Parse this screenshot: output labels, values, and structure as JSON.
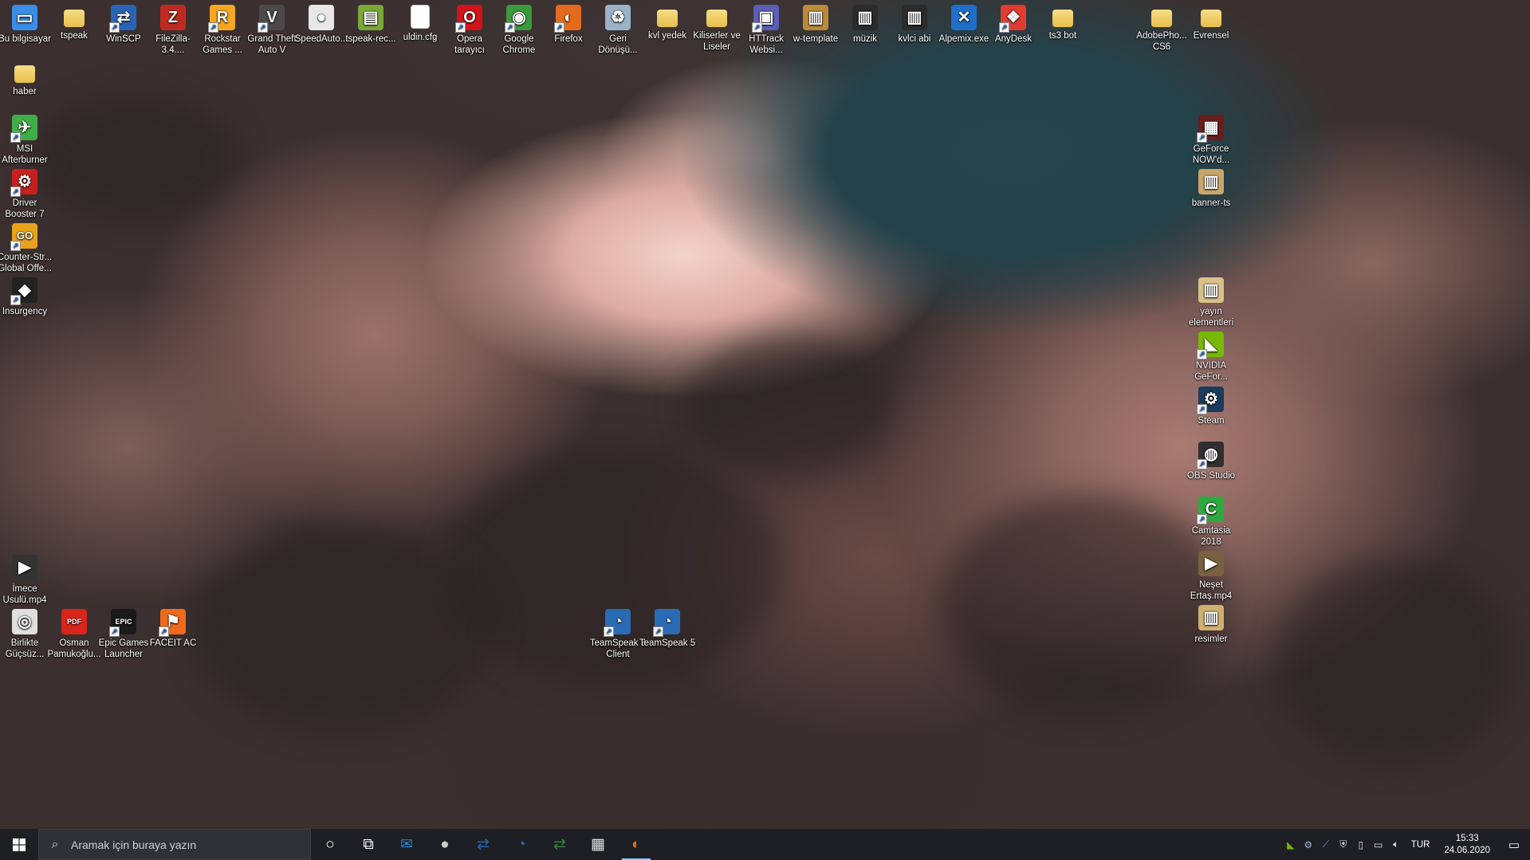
{
  "desktop": {
    "icons_top_row": [
      {
        "name": "bu-bilgisayar",
        "label": "Bu bilgisayar",
        "kind": "computer",
        "color": "#3a8ee8",
        "short": false
      },
      {
        "name": "tspeak",
        "label": "tspeak",
        "kind": "folder",
        "color": "#f0cc5c",
        "short": false
      },
      {
        "name": "winscp",
        "label": "WinSCP",
        "kind": "app",
        "color": "#2b63b7",
        "glyph": "⇄",
        "short": true
      },
      {
        "name": "filezilla",
        "label": "FileZilla-3.4....",
        "kind": "app",
        "color": "#bf2b20",
        "glyph": "Z",
        "short": false
      },
      {
        "name": "rockstar-games",
        "label": "Rockstar Games ...",
        "kind": "app",
        "color": "#f5a623",
        "glyph": "R",
        "short": true
      },
      {
        "name": "gta-v",
        "label": "Grand Theft Auto V",
        "kind": "app",
        "color": "#4a4a4a",
        "glyph": "V",
        "short": true
      },
      {
        "name": "speedauto",
        "label": "SpeedAuto...",
        "kind": "app",
        "color": "#e8e8e8",
        "glyph": "●",
        "short": false
      },
      {
        "name": "tspeak-rec",
        "label": "tspeak-rec...",
        "kind": "app",
        "color": "#7aa63a",
        "glyph": "▤",
        "short": false
      },
      {
        "name": "uldin-cfg",
        "label": "uldin.cfg",
        "kind": "doc",
        "color": "#ffffff",
        "short": false
      },
      {
        "name": "opera",
        "label": "Opera tarayıcı",
        "kind": "app",
        "color": "#d0141b",
        "glyph": "O",
        "short": true
      },
      {
        "name": "google-chrome",
        "label": "Google Chrome",
        "kind": "app",
        "color": "#3b9a3b",
        "glyph": "◉",
        "short": true
      },
      {
        "name": "firefox",
        "label": "Firefox",
        "kind": "app",
        "color": "#e66a1b",
        "glyph": "◐",
        "short": true
      },
      {
        "name": "geri-donusum",
        "label": "Geri Dönüşü...",
        "kind": "app",
        "color": "#9ab3c8",
        "glyph": "♻",
        "short": false
      },
      {
        "name": "kvl-yedek",
        "label": "kvl yedek",
        "kind": "folder",
        "color": "#f0cc5c",
        "short": false
      },
      {
        "name": "kiliserler-ve-liseler",
        "label": "Kiliserler ve Liseler",
        "kind": "folder",
        "color": "#f0cc5c",
        "short": false
      },
      {
        "name": "httrack",
        "label": "HTTrack Websi...",
        "kind": "app",
        "color": "#5b5fb6",
        "glyph": "▣",
        "short": true
      },
      {
        "name": "w-template",
        "label": "w-template",
        "kind": "app",
        "color": "#b88a3a",
        "glyph": "▥",
        "short": false
      },
      {
        "name": "muzik",
        "label": "müzik",
        "kind": "app",
        "color": "#2b2b2b",
        "glyph": "▥",
        "short": false
      },
      {
        "name": "kvlci-abi",
        "label": "kvlci abi",
        "kind": "app",
        "color": "#2b2b2b",
        "glyph": "▥",
        "short": false
      },
      {
        "name": "alpemix",
        "label": "Alpemix.exe",
        "kind": "app",
        "color": "#1f6fc9",
        "glyph": "✕",
        "short": false
      },
      {
        "name": "anydesk",
        "label": "AnyDesk",
        "kind": "app",
        "color": "#e03c31",
        "glyph": "❖",
        "short": true
      },
      {
        "name": "ts3-bot",
        "label": "ts3 bot",
        "kind": "folder",
        "color": "#f0cc5c",
        "short": false
      },
      {
        "name": "adobephoto-cs6",
        "label": "AdobePho... CS6",
        "kind": "folder",
        "color": "#f0cc5c",
        "short": false
      },
      {
        "name": "evrensel",
        "label": "Evrensel",
        "kind": "folder",
        "color": "#f0cc5c",
        "short": false
      }
    ],
    "icons_left_col": [
      {
        "name": "haber",
        "label": "haber",
        "kind": "folder",
        "color": "#f0cc5c",
        "short": false
      },
      {
        "name": "msi-afterburner",
        "label": "MSI Afterburner",
        "kind": "app",
        "color": "#3fae49",
        "glyph": "✈",
        "short": true
      },
      {
        "name": "driver-booster-7",
        "label": "Driver Booster 7",
        "kind": "app",
        "color": "#c8201e",
        "glyph": "⚙",
        "short": true
      },
      {
        "name": "csgo",
        "label": "Counter-Str... Global Offe...",
        "kind": "app",
        "color": "#e8a21b",
        "glyph": "GO",
        "short": true
      },
      {
        "name": "insurgency",
        "label": "Insurgency",
        "kind": "app",
        "color": "#222222",
        "glyph": "◆",
        "short": true
      },
      {
        "name": "imece-usulu",
        "label": "İmece Usulü.mp4",
        "kind": "app",
        "color": "#333333",
        "glyph": "▶",
        "short": false
      },
      {
        "name": "birlikte-gucsuz",
        "label": "Birlikte Güçsüz...",
        "kind": "app",
        "color": "#e0e0e0",
        "glyph": "◎",
        "short": false
      },
      {
        "name": "osman-pamukoglu",
        "label": "Osman Pamukoğlu...",
        "kind": "app",
        "color": "#d9241b",
        "glyph": "PDF",
        "short": false
      },
      {
        "name": "epic-games-launcher",
        "label": "Epic Games Launcher",
        "kind": "app",
        "color": "#1a1a1a",
        "glyph": "EPIC",
        "short": true
      },
      {
        "name": "faceit-ac",
        "label": "FACEIT AC",
        "kind": "app",
        "color": "#f06a1b",
        "glyph": "⚑",
        "short": true
      }
    ],
    "icons_right_col": [
      {
        "name": "geforce-now",
        "label": "GeForce NOW'd...",
        "kind": "app",
        "color": "#6b1c1c",
        "glyph": "▦",
        "short": true
      },
      {
        "name": "banner-ts",
        "label": "banner-ts",
        "kind": "app",
        "color": "#c8a66a",
        "glyph": "▥",
        "short": false
      },
      {
        "name": "yayin-elementleri",
        "label": "yayın elementleri",
        "kind": "app",
        "color": "#d9c08a",
        "glyph": "▥",
        "short": false
      },
      {
        "name": "nvidia-geforce",
        "label": "NVIDIA GeFor...",
        "kind": "app",
        "color": "#76b900",
        "glyph": "◣",
        "short": true
      },
      {
        "name": "steam",
        "label": "Steam",
        "kind": "app",
        "color": "#1b3b5c",
        "glyph": "⚙",
        "short": true
      },
      {
        "name": "obs-studio",
        "label": "OBS Studio",
        "kind": "app",
        "color": "#302e31",
        "glyph": "◍",
        "short": true
      },
      {
        "name": "camtasia-2018",
        "label": "Camtasia 2018",
        "kind": "app",
        "color": "#2fa83f",
        "glyph": "C",
        "short": true
      },
      {
        "name": "neset-ertas",
        "label": "Neşet Ertaş.mp4",
        "kind": "app",
        "color": "#7a6040",
        "glyph": "▶",
        "short": false
      },
      {
        "name": "resimler",
        "label": "resimler",
        "kind": "app",
        "color": "#d0b070",
        "glyph": "▥",
        "short": false
      }
    ],
    "icons_center": [
      {
        "name": "teamspeak-3-client",
        "label": "TeamSpeak 3 Client",
        "kind": "app",
        "color": "#2a6bb5",
        "glyph": "◔",
        "short": true
      },
      {
        "name": "teamspeak-5",
        "label": "TeamSpeak 5",
        "kind": "app",
        "color": "#2a6bb5",
        "glyph": "◔",
        "short": true
      }
    ]
  },
  "taskbar": {
    "search_placeholder": "Aramak için buraya yazın",
    "pinned": [
      {
        "name": "cortana-button",
        "glyph": "○",
        "color": "#ffffff"
      },
      {
        "name": "task-view-button",
        "glyph": "⧉",
        "color": "#ffffff"
      },
      {
        "name": "mail-app",
        "glyph": "✉",
        "color": "#1f8ad6"
      },
      {
        "name": "speedauto-app",
        "glyph": "●",
        "color": "#cccccc"
      },
      {
        "name": "network-app",
        "glyph": "⇄",
        "color": "#2b63b7"
      },
      {
        "name": "teamspeak-app",
        "glyph": "◔",
        "color": "#2a6bb5"
      },
      {
        "name": "winscp-app",
        "glyph": "⇄",
        "color": "#3a7e3a"
      },
      {
        "name": "calculator-app",
        "glyph": "▦",
        "color": "#e6e6e6"
      },
      {
        "name": "firefox-task",
        "glyph": "◐",
        "color": "#e66a1b"
      }
    ],
    "tray_icons": [
      "nvidia-tray-icon",
      "steam-tray-icon",
      "camtasia-tray-icon",
      "windows-defender-icon",
      "usb-icon",
      "network-icon",
      "volume-icon"
    ],
    "language": "TUR",
    "time": "15:33",
    "date": "24.06.2020"
  }
}
